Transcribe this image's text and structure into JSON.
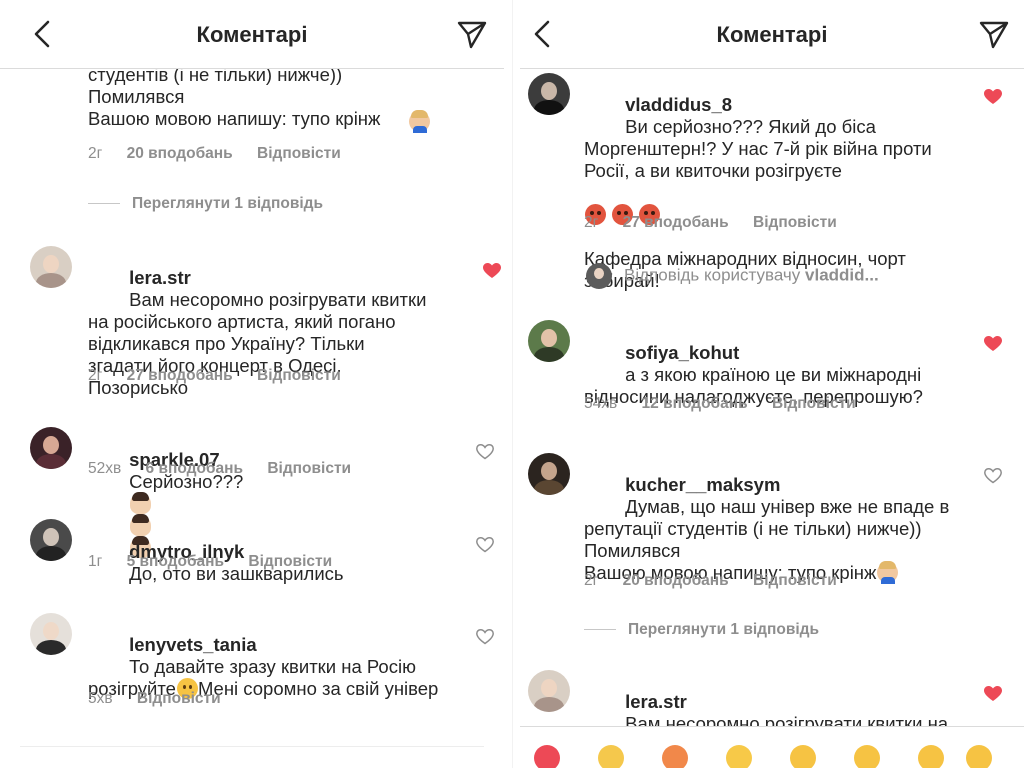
{
  "header": {
    "title": "Коментарі"
  },
  "left": {
    "partial_comment": {
      "text": "студентів (і не тільки) нижче))\nПомилявся\nВашою мовою напишу: тупо крінж",
      "time": "2г",
      "likes": "20 вподобань",
      "reply": "Відповісти"
    },
    "view_replies": "Переглянути 1 відповідь",
    "comments": [
      {
        "user": "lera.str",
        "text": "Вам несоромно розігрувати квитки на російського артиста, який погано відкликався про Україну? Тільки згадати його концерт в Одесі. Позорисько",
        "time": "2г",
        "likes": "27 вподобань",
        "reply": "Відповісти",
        "liked": true
      },
      {
        "user": "sparkle.07",
        "text": "Серйозно???",
        "time": "52хв",
        "likes": "6 вподобань",
        "reply": "Відповісти",
        "liked": false
      },
      {
        "user": "dmytro_ilnyk",
        "text": "До, ото ви зашкварились",
        "time": "1г",
        "likes": "5 вподобань",
        "reply": "Відповісти",
        "liked": false
      },
      {
        "user": "lenyvets_tania",
        "text": "То давайте зразу квитки на Росію розігруйте",
        "text2": "Мені соромно за свій універ",
        "time": "5хв",
        "likes": "",
        "reply": "Відповісти",
        "liked": false
      }
    ]
  },
  "right": {
    "comments": [
      {
        "user": "vladdidus_8",
        "text": "Ви серйозно??? Який до біса Моргенштерн!? У нас 7-й рік війна проти Росії, а ви квиточки розігруєте",
        "text2": "Кафедра міжнародних відносин, чорт забирай!",
        "time": "2г",
        "likes": "27 вподобань",
        "reply": "Відповісти",
        "liked": true
      },
      {
        "user": "sofiya_kohut",
        "text": "а з якою країною це ви міжнародні відносини налагоджуєте, перепрошую?",
        "time": "54хв",
        "likes": "12 вподобань",
        "reply": "Відповісти",
        "liked": true
      },
      {
        "user": "kucher__maksym",
        "text": "Думав, що наш універ вже не впаде в репутації студентів (і не тільки) нижче))\nПомилявся\nВашою мовою напишу: тупо крінж",
        "time": "2г",
        "likes": "20 вподобань",
        "reply": "Відповісти",
        "liked": false
      },
      {
        "user": "lera.str",
        "text": "Вам несоромно розігрувати квитки на російського артиста, який погано відкликався про Україну?",
        "liked": true
      }
    ],
    "reply_to": {
      "prefix": "Відповідь користувачу",
      "user": "vladdid..."
    },
    "view_replies": "Переглянути 1 відповідь"
  },
  "colors": {
    "heart_liked": "#ed4956",
    "meta_text": "#8e8e8e",
    "primary_text": "#262626"
  },
  "icons": {
    "back": "chevron-left-icon",
    "send": "paper-plane-icon",
    "like": "heart-icon"
  }
}
